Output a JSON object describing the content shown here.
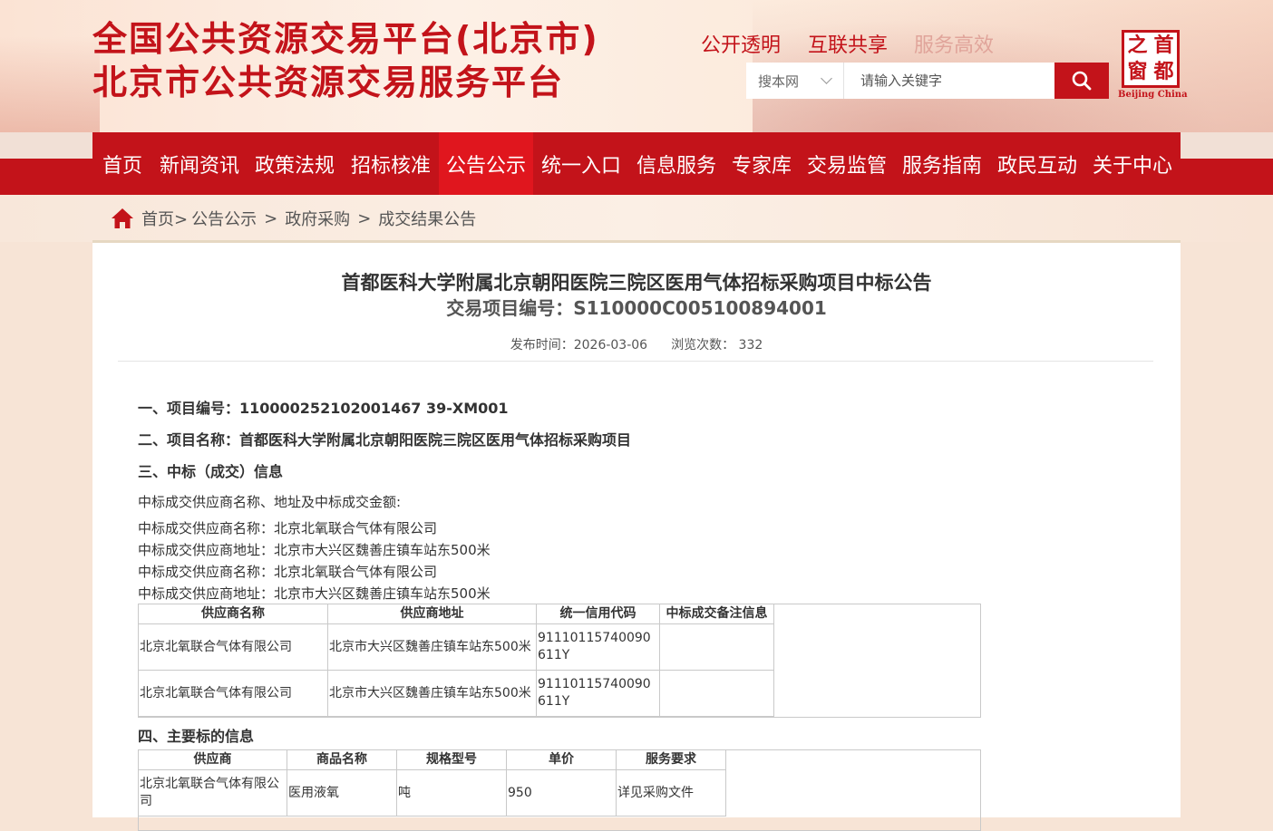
{
  "header": {
    "title_line1": "全国公共资源交易平台(北京市)",
    "title_line2": "北京市公共资源交易服务平台",
    "slogans": [
      "公开透明",
      "互联共享",
      "服务高效"
    ],
    "search": {
      "scope": "搜本网",
      "placeholder": "请输入关键字"
    },
    "logo": {
      "chars": [
        "之",
        "首",
        "窗",
        "都"
      ],
      "english": "Beijing China"
    }
  },
  "nav": {
    "items": [
      "首页",
      "新闻资讯",
      "政策法规",
      "招标核准",
      "公告公示",
      "统一入口",
      "信息服务",
      "专家库",
      "交易监管",
      "服务指南",
      "政民互动",
      "关于中心"
    ],
    "active_index": 4
  },
  "breadcrumb": {
    "items": [
      "首页>",
      "公告公示",
      ">",
      "政府采购",
      ">",
      "成交结果公告"
    ]
  },
  "notice": {
    "title": "首都医科大学附属北京朝阳医院三院区医用气体招标采购项目中标公告",
    "project_code": "交易项目编号：S110000C005100894001",
    "publish_label": "发布时间：2026-03-06",
    "views_label": "浏览次数：",
    "views": "332",
    "sections": {
      "s1": "一、项目编号：110000252102001467 39-XM001",
      "s2": "二、项目名称：首都医科大学附属北京朝阳医院三院区医用气体招标采购项目",
      "s3": "三、中标（成交）信息",
      "s4": "四、主要标的信息"
    },
    "winner_intro": "中标成交供应商名称、地址及中标成交金额:",
    "winner_lines": [
      "中标成交供应商名称：北京北氧联合气体有限公司",
      "中标成交供应商地址：北京市大兴区魏善庄镇车站东500米",
      "中标成交供应商名称：北京北氧联合气体有限公司",
      "中标成交供应商地址：北京市大兴区魏善庄镇车站东500米"
    ],
    "winner_table": {
      "headers": [
        "供应商名称",
        "供应商地址",
        "统一信用代码",
        "中标成交备注信息"
      ],
      "rows": [
        [
          "北京北氧联合气体有限公司",
          "北京市大兴区魏善庄镇车站东500米",
          "91110115740090611Y",
          ""
        ],
        [
          "北京北氧联合气体有限公司",
          "北京市大兴区魏善庄镇车站东500米",
          "91110115740090611Y",
          ""
        ]
      ]
    },
    "goods_table": {
      "headers": [
        "供应商",
        "商品名称",
        "规格型号",
        "单价",
        "服务要求"
      ],
      "rows": [
        [
          "北京北氧联合气体有限公司",
          "医用液氧",
          "吨",
          "950",
          "详见采购文件"
        ]
      ]
    }
  },
  "colors": {
    "brand_red": "#c3131a",
    "nav_active": "#e0161e",
    "slogan_faded": "#e0a49a"
  }
}
